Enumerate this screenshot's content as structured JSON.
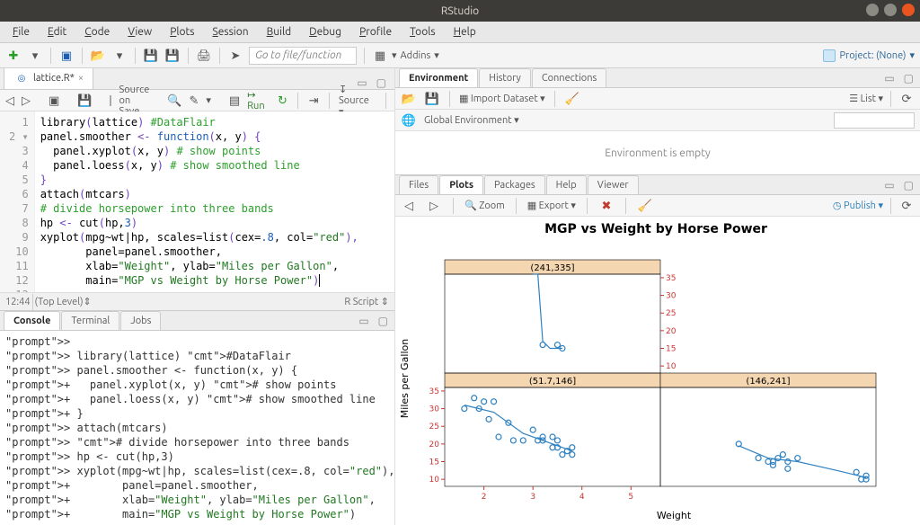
{
  "app_title": "RStudio",
  "menubar": [
    "File",
    "Edit",
    "Code",
    "View",
    "Plots",
    "Session",
    "Build",
    "Debug",
    "Profile",
    "Tools",
    "Help"
  ],
  "toolbar": {
    "goto_placeholder": "Go to file/function",
    "addins_label": "Addins",
    "project_label": "Project: (None)"
  },
  "source": {
    "tab_name": "lattice.R*",
    "source_on_save": "Source on Save",
    "run": "Run",
    "source_btn": "Source",
    "lines": [
      {
        "n": "1",
        "tokens": [
          [
            "library",
            "fn"
          ],
          [
            "(",
            "p"
          ],
          [
            "lattice",
            "fn"
          ],
          [
            ") ",
            "p"
          ],
          [
            "#DataFlair",
            "com"
          ]
        ]
      },
      {
        "n": "2 ▾",
        "tokens": [
          [
            "panel.smoother ",
            "fn"
          ],
          [
            "<- ",
            "p"
          ],
          [
            "function",
            "key"
          ],
          [
            "(",
            "p"
          ],
          [
            "x, y",
            "fn"
          ],
          [
            ") {",
            "p"
          ]
        ]
      },
      {
        "n": "3",
        "tokens": [
          [
            "  panel.xyplot",
            "fn"
          ],
          [
            "(",
            "p"
          ],
          [
            "x, y",
            "fn"
          ],
          [
            ") ",
            "p"
          ],
          [
            "# show points",
            "com"
          ]
        ]
      },
      {
        "n": "4",
        "tokens": [
          [
            "  panel.loess",
            "fn"
          ],
          [
            "(",
            "p"
          ],
          [
            "x, y",
            "fn"
          ],
          [
            ") ",
            "p"
          ],
          [
            "# show smoothed line",
            "com"
          ]
        ]
      },
      {
        "n": "5",
        "tokens": [
          [
            "}",
            "p"
          ]
        ]
      },
      {
        "n": "6",
        "tokens": [
          [
            "attach",
            "fn"
          ],
          [
            "(",
            "p"
          ],
          [
            "mtcars",
            "fn"
          ],
          [
            ")",
            "p"
          ]
        ]
      },
      {
        "n": "7",
        "tokens": [
          [
            "# divide horsepower into three bands",
            "com"
          ]
        ]
      },
      {
        "n": "8",
        "tokens": [
          [
            "hp ",
            "fn"
          ],
          [
            "<- ",
            "p"
          ],
          [
            "cut",
            "fn"
          ],
          [
            "(",
            "p"
          ],
          [
            "hp,",
            "fn"
          ],
          [
            "3",
            "key"
          ],
          [
            ")",
            "p"
          ]
        ]
      },
      {
        "n": "9",
        "tokens": [
          [
            "xyplot",
            "fn"
          ],
          [
            "(",
            "p"
          ],
          [
            "mpg~wt|hp, scales=",
            "fn"
          ],
          [
            "list",
            "fn"
          ],
          [
            "(",
            "p"
          ],
          [
            "cex=",
            "fn"
          ],
          [
            ".8",
            "key"
          ],
          [
            ", col=",
            "fn"
          ],
          [
            "\"red\"",
            "str"
          ],
          [
            "),",
            "p"
          ]
        ]
      },
      {
        "n": "10",
        "tokens": [
          [
            "       panel=panel.smoother,",
            "fn"
          ]
        ]
      },
      {
        "n": "11",
        "tokens": [
          [
            "       xlab=",
            "fn"
          ],
          [
            "\"Weight\"",
            "str"
          ],
          [
            ", ylab=",
            "fn"
          ],
          [
            "\"Miles per Gallon\"",
            "str"
          ],
          [
            ",",
            "fn"
          ]
        ]
      },
      {
        "n": "12",
        "tokens": [
          [
            "       main=",
            "fn"
          ],
          [
            "\"MGP vs Weight by Horse Power\"",
            "str"
          ],
          [
            ")",
            "p"
          ],
          [
            "|",
            "cursor"
          ]
        ]
      },
      {
        "n": "13",
        "tokens": [
          [
            "",
            ""
          ]
        ]
      }
    ],
    "status_pos": "12:44",
    "status_scope": "(Top Level)",
    "status_type": "R Script"
  },
  "console": {
    "tabs": [
      "Console",
      "Terminal",
      "Jobs"
    ],
    "lines": [
      "> ",
      "> library(lattice) #DataFlair",
      "> panel.smoother <- function(x, y) {",
      "+   panel.xyplot(x, y) # show points",
      "+   panel.loess(x, y) # show smoothed line",
      "+ }",
      "> attach(mtcars)",
      "> # divide horsepower into three bands",
      "> hp <- cut(hp,3)",
      "> xyplot(mpg~wt|hp, scales=list(cex=.8, col=\"red\"),",
      "+        panel=panel.smoother,",
      "+        xlab=\"Weight\", ylab=\"Miles per Gallon\",",
      "+        main=\"MGP vs Weight by Horse Power\")"
    ]
  },
  "environment": {
    "tabs": [
      "Environment",
      "History",
      "Connections"
    ],
    "import": "Import Dataset",
    "scope": "Global Environment",
    "list": "List",
    "empty": "Environment is empty"
  },
  "plots": {
    "tabs": [
      "Files",
      "Plots",
      "Packages",
      "Help",
      "Viewer"
    ],
    "zoom": "Zoom",
    "export": "Export",
    "publish": "Publish"
  },
  "chart_data": {
    "type": "scatter",
    "title": "MGP vs Weight by Horse Power",
    "xlabel": "Weight",
    "ylabel": "Miles per Gallon",
    "x_ticks": [
      2,
      3,
      4,
      5
    ],
    "panels": [
      {
        "strip": "(51.7,146]",
        "row": 0,
        "col": 0,
        "y_ticks": [
          10,
          15,
          20,
          25,
          30,
          35
        ],
        "points": [
          {
            "x": 1.6,
            "y": 30
          },
          {
            "x": 1.8,
            "y": 33
          },
          {
            "x": 1.9,
            "y": 30
          },
          {
            "x": 2.0,
            "y": 32
          },
          {
            "x": 2.1,
            "y": 27
          },
          {
            "x": 2.2,
            "y": 32
          },
          {
            "x": 2.3,
            "y": 22
          },
          {
            "x": 2.5,
            "y": 26
          },
          {
            "x": 2.6,
            "y": 21
          },
          {
            "x": 2.8,
            "y": 21
          },
          {
            "x": 3.0,
            "y": 24
          },
          {
            "x": 3.1,
            "y": 21
          },
          {
            "x": 3.2,
            "y": 21
          },
          {
            "x": 3.2,
            "y": 22
          },
          {
            "x": 3.4,
            "y": 19
          },
          {
            "x": 3.4,
            "y": 22
          },
          {
            "x": 3.5,
            "y": 19
          },
          {
            "x": 3.5,
            "y": 21
          },
          {
            "x": 3.6,
            "y": 17
          },
          {
            "x": 3.7,
            "y": 18
          },
          {
            "x": 3.8,
            "y": 17
          },
          {
            "x": 3.8,
            "y": 19
          }
        ],
        "smooth": [
          {
            "x": 1.6,
            "y": 31
          },
          {
            "x": 2.2,
            "y": 29
          },
          {
            "x": 2.8,
            "y": 23
          },
          {
            "x": 3.4,
            "y": 20
          },
          {
            "x": 3.8,
            "y": 18
          }
        ]
      },
      {
        "strip": "(146,241]",
        "row": 0,
        "col": 1,
        "y_ticks": [
          10,
          15,
          20,
          25,
          30,
          35
        ],
        "points": [
          {
            "x": 2.8,
            "y": 20
          },
          {
            "x": 3.2,
            "y": 16
          },
          {
            "x": 3.4,
            "y": 15
          },
          {
            "x": 3.5,
            "y": 14
          },
          {
            "x": 3.5,
            "y": 15
          },
          {
            "x": 3.6,
            "y": 16
          },
          {
            "x": 3.7,
            "y": 17
          },
          {
            "x": 3.8,
            "y": 13
          },
          {
            "x": 3.8,
            "y": 15
          },
          {
            "x": 4.0,
            "y": 16
          },
          {
            "x": 5.2,
            "y": 12
          },
          {
            "x": 5.3,
            "y": 10
          },
          {
            "x": 5.4,
            "y": 11
          },
          {
            "x": 5.4,
            "y": 10
          }
        ],
        "smooth": [
          {
            "x": 2.8,
            "y": 19.5
          },
          {
            "x": 3.4,
            "y": 16
          },
          {
            "x": 4.0,
            "y": 15
          },
          {
            "x": 4.8,
            "y": 12.5
          },
          {
            "x": 5.4,
            "y": 10.5
          }
        ]
      },
      {
        "strip": "(241,335]",
        "row": 1,
        "col": 0,
        "y_ticks": [
          10,
          15,
          20,
          25,
          30,
          35
        ],
        "points": [
          {
            "x": 3.2,
            "y": 16
          },
          {
            "x": 3.5,
            "y": 16
          },
          {
            "x": 3.6,
            "y": 15
          }
        ],
        "smooth": [
          {
            "x": 3.0,
            "y": 100
          },
          {
            "x": 3.1,
            "y": 100
          },
          {
            "x": 3.2,
            "y": 17
          },
          {
            "x": 3.35,
            "y": 15
          },
          {
            "x": 3.5,
            "y": 15
          },
          {
            "x": 3.6,
            "y": 15
          }
        ]
      }
    ],
    "x_range": [
      1.2,
      5.6
    ],
    "y_range": [
      8,
      36
    ],
    "strip_bg": "#f4d6b1",
    "point_stroke": "#2f81c1",
    "axis_tick_color": "#cc3333"
  }
}
